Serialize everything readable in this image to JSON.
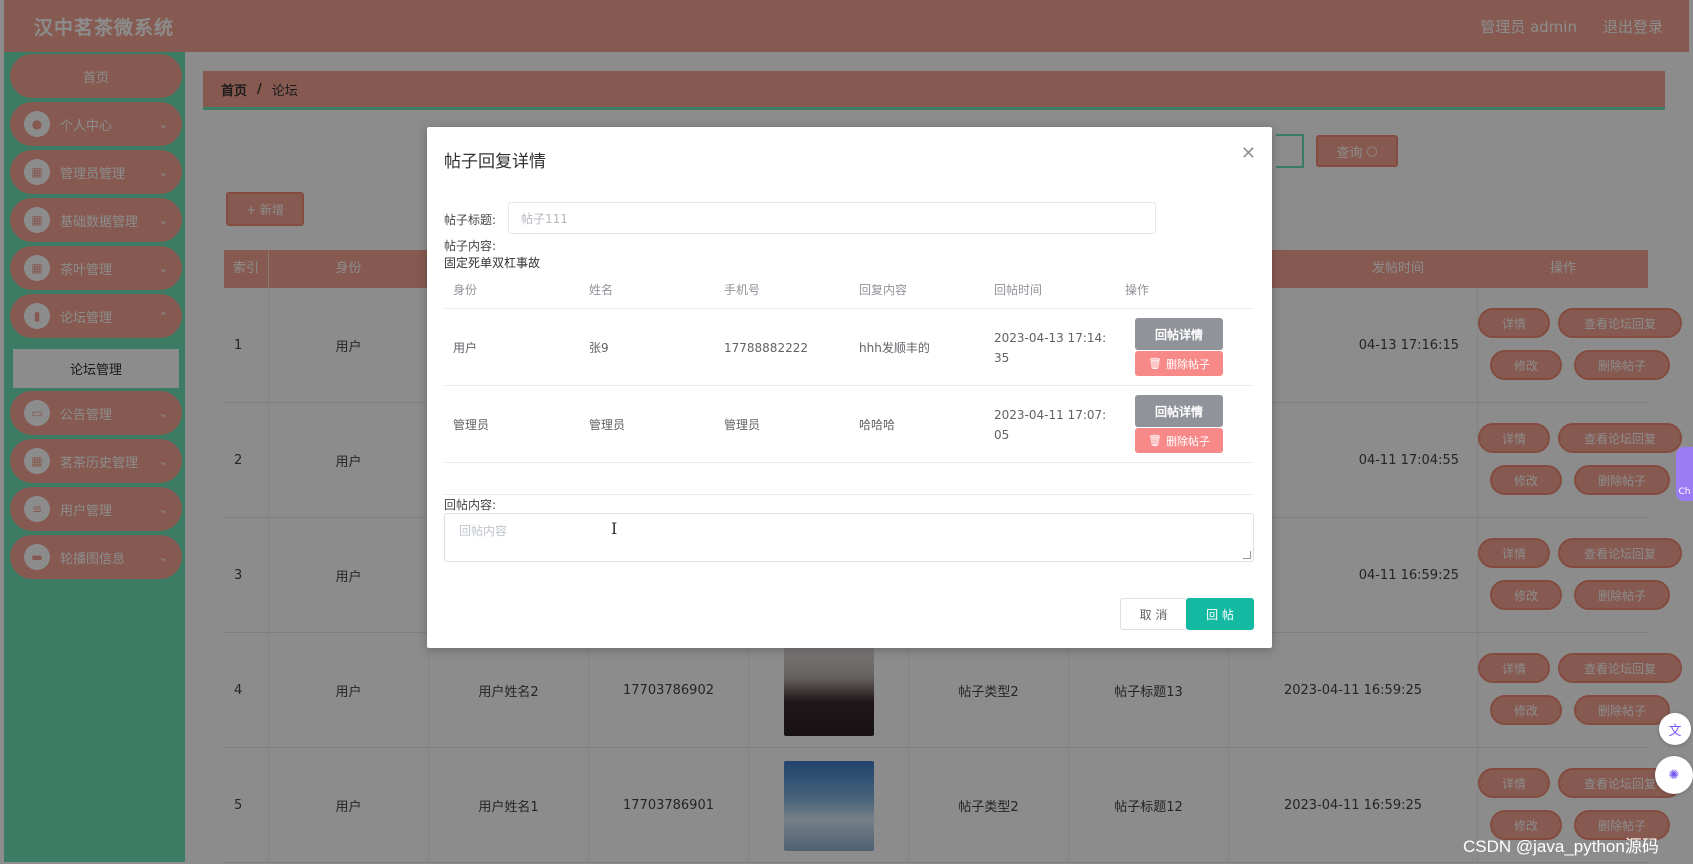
{
  "app": {
    "brand": "汉中茗茶微系统",
    "user_label": "管理员 admin",
    "logout_label": "退出登录"
  },
  "sidebar": {
    "home": "首页",
    "items": [
      {
        "label": "个人中心",
        "icon": "user-icon"
      },
      {
        "label": "管理员管理",
        "icon": "grid-icon"
      },
      {
        "label": "基础数据管理",
        "icon": "grid-icon"
      },
      {
        "label": "茶叶管理",
        "icon": "grid-icon"
      },
      {
        "label": "论坛管理",
        "icon": "chart-icon"
      },
      {
        "label": "公告管理",
        "icon": "monitor-icon"
      },
      {
        "label": "茗茶历史管理",
        "icon": "grid-icon"
      },
      {
        "label": "用户管理",
        "icon": "list-icon"
      },
      {
        "label": "轮播图信息",
        "icon": "message-icon"
      }
    ],
    "sub_active": "论坛管理"
  },
  "breadcrumb": {
    "home": "首页",
    "sep": "/",
    "current": "论坛"
  },
  "toolbar": {
    "query_label": "查询",
    "add_label": "+ 新增"
  },
  "table": {
    "headers": [
      "索引",
      "身份",
      "发帖时间",
      "操作"
    ],
    "rows": [
      {
        "index": "1",
        "role": "用户",
        "name": "",
        "phone": "",
        "type": "",
        "title": "",
        "time": "04-13 17:16:15"
      },
      {
        "index": "2",
        "role": "用户",
        "name": "",
        "phone": "",
        "type": "",
        "title": "",
        "time": "04-11 17:04:55"
      },
      {
        "index": "3",
        "role": "用户",
        "name": "",
        "phone": "",
        "type": "",
        "title": "",
        "time": "04-11 16:59:25"
      },
      {
        "index": "4",
        "role": "用户",
        "name": "用户姓名2",
        "phone": "17703786902",
        "type": "帖子类型2",
        "title": "帖子标题13",
        "time": "2023-04-11 16:59:25"
      },
      {
        "index": "5",
        "role": "用户",
        "name": "用户姓名1",
        "phone": "17703786901",
        "type": "帖子类型2",
        "title": "帖子标题12",
        "time": "2023-04-11 16:59:25"
      }
    ],
    "ops": {
      "detail": "详情",
      "view_replies": "查看论坛回复",
      "edit": "修改",
      "delete": "删除帖子"
    }
  },
  "dialog": {
    "title": "帖子回复详情",
    "title_label": "帖子标题:",
    "title_value": "帖子111",
    "content_label": "帖子内容:",
    "content_value": "固定死单双杠事故",
    "columns": [
      "身份",
      "姓名",
      "手机号",
      "回复内容",
      "回帖时间",
      "操作"
    ],
    "replies": [
      {
        "role": "用户",
        "name": "张9",
        "phone": "17788882222",
        "content": "hhh发顺丰的",
        "time_line1": "2023-04-13 17:14:",
        "time_line2": "35"
      },
      {
        "role": "管理员",
        "name": "管理员",
        "phone": "管理员",
        "content": "哈哈哈",
        "time_line1": "2023-04-11 17:07:",
        "time_line2": "05"
      }
    ],
    "reply_detail_label": "回帖详情",
    "delete_label": "删除帖子",
    "reply_label": "回帖内容:",
    "reply_placeholder": "回帖内容",
    "cancel_label": "取 消",
    "submit_label": "回 帖"
  },
  "watermark": "CSDN @java_python源码",
  "chat_tab": "Ch"
}
